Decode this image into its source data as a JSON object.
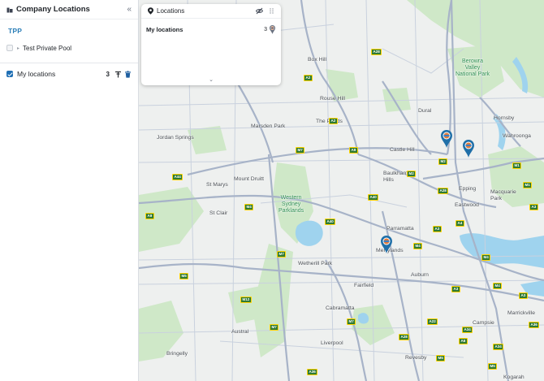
{
  "sidebar": {
    "title": "Company Locations",
    "collapse_icon": "«",
    "group_label": "TPP",
    "pool": {
      "label": "Test Private Pool",
      "checked": false
    },
    "my_locations": {
      "label": "My locations",
      "count": "3",
      "checked": true
    }
  },
  "panel": {
    "title": "Locations",
    "row_label": "My locations",
    "row_count": "3",
    "expand_icon": "⌄"
  },
  "map": {
    "places": {
      "box_hill": "Box Hill",
      "rouse_hill": "Rouse Hill",
      "the_ponds": "The Ponds",
      "marsden_park": "Marsden Park",
      "jordan_springs": "Jordan Springs",
      "mount_druitt": "Mount Druitt",
      "st_marys": "St Marys",
      "st_clair": "St Clair",
      "castle_hill": "Castle Hill",
      "baulkham_hills": "Baulkham\nHills",
      "dural": "Dural",
      "hornsby": "Hornsby",
      "wahroonga": "Wahroonga",
      "berowra": "Berowra\nValley\nNational Park",
      "epping": "Epping",
      "macquarie_park": "Macquarie\nPark",
      "eastwood": "Eastwood",
      "western_sydney": "Western\nSydney\nParklands",
      "parramatta": "Parramatta",
      "merrylands": "Merrylands",
      "wetherill_park": "Wetherill Park",
      "fairfield": "Fairfield",
      "auburn": "Auburn",
      "cabramatta": "Cabramatta",
      "austral": "Austral",
      "bringelly": "Bringelly",
      "liverpool": "Liverpool",
      "campsie": "Campsie",
      "marrickville": "Marrickville",
      "revesby": "Revesby",
      "kogarah": "Kogarah"
    },
    "shields": [
      "A2",
      "A2",
      "A28",
      "M7",
      "A9",
      "M2",
      "M2",
      "A44",
      "A40",
      "M4",
      "A9",
      "A40",
      "A3",
      "M4",
      "A28",
      "M4",
      "M4",
      "M7",
      "A3",
      "M5",
      "M12",
      "M7",
      "M7",
      "A22",
      "A6",
      "A34",
      "M5",
      "A36",
      "A3",
      "A36",
      "M1",
      "A4",
      "A28",
      "A34",
      "M1",
      "A3",
      "M5"
    ],
    "colors": {
      "road_major": "#a7b3c8",
      "road_minor": "#c9d1de",
      "park": "#cfe8c8",
      "water": "#9fd3ee",
      "pin": "#1f6fa8"
    }
  }
}
